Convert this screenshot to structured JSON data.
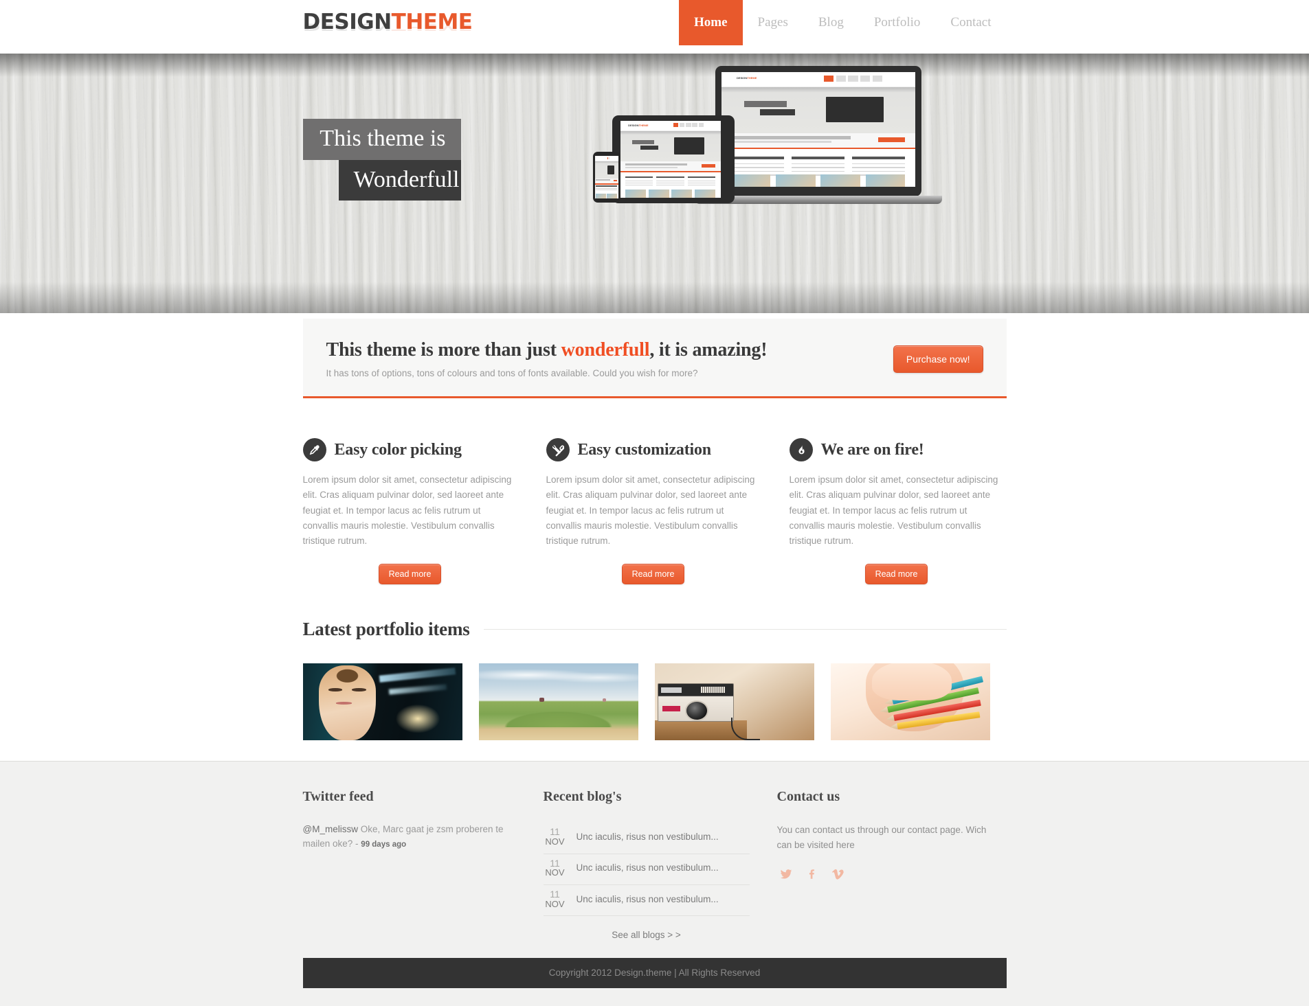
{
  "header": {
    "logo": {
      "part1": "DESIGN",
      "part2": "THEME"
    },
    "nav": [
      {
        "label": "Home",
        "active": true
      },
      {
        "label": "Pages",
        "active": false
      },
      {
        "label": "Blog",
        "active": false
      },
      {
        "label": "Portfolio",
        "active": false
      },
      {
        "label": "Contact",
        "active": false
      }
    ]
  },
  "hero": {
    "caption_line1": "This theme is",
    "caption_line2": "Wonderfull",
    "mockup_logo1": "DESIGN",
    "mockup_logo2": "THEME"
  },
  "cta": {
    "heading_pre": "This theme is more than just ",
    "heading_highlight": "wonderfull",
    "heading_post": ", it is amazing!",
    "subheading": "It has tons of options, tons of colours and tons of fonts available. Could you wish for more?",
    "button_label": "Purchase now!"
  },
  "features": [
    {
      "icon": "eyedropper-icon",
      "title": "Easy color picking",
      "body": "Lorem ipsum dolor sit amet, consectetur adipiscing elit. Cras aliquam pulvinar dolor, sed laoreet ante feugiat et. In tempor lacus ac felis rutrum ut convallis mauris molestie. Vestibulum convallis tristique rutrum.",
      "button_label": "Read more"
    },
    {
      "icon": "tools-icon",
      "title": "Easy customization",
      "body": "Lorem ipsum dolor sit amet, consectetur adipiscing elit. Cras aliquam pulvinar dolor, sed laoreet ante feugiat et. In tempor lacus ac felis rutrum ut convallis mauris molestie. Vestibulum convallis tristique rutrum.",
      "button_label": "Read more"
    },
    {
      "icon": "flame-icon",
      "title": "We are on fire!",
      "body": "Lorem ipsum dolor sit amet, consectetur adipiscing elit. Cras aliquam pulvinar dolor, sed laoreet ante feugiat et. In tempor lacus ac felis rutrum ut convallis mauris molestie. Vestibulum convallis tristique rutrum.",
      "button_label": "Read more"
    }
  ],
  "portfolio": {
    "title": "Latest portfolio items",
    "items": [
      {
        "alt": "portrait-woman-teal-lights"
      },
      {
        "alt": "beach-grass-field-horizon"
      },
      {
        "alt": "vintage-kodak-camera"
      },
      {
        "alt": "hand-holding-colored-pencils"
      }
    ]
  },
  "footer": {
    "twitter": {
      "title": "Twitter feed",
      "handle": "@M_melissw",
      "text": " Oke, Marc gaat je zsm proberen te mailen oke? - ",
      "ago": "99 days ago"
    },
    "blog": {
      "title": "Recent blog's",
      "posts": [
        {
          "day": "11",
          "month": "NOV",
          "text": "Unc iaculis, risus non vestibulum..."
        },
        {
          "day": "11",
          "month": "NOV",
          "text": "Unc iaculis, risus non vestibulum..."
        },
        {
          "day": "11",
          "month": "NOV",
          "text": "Unc iaculis, risus non vestibulum..."
        }
      ],
      "see_all": "See all blogs > >"
    },
    "contact": {
      "title": "Contact us",
      "text": "You can contact us through our contact page. Wich can be visited here",
      "socials": [
        {
          "icon": "twitter-icon",
          "name": "twitter"
        },
        {
          "icon": "facebook-icon",
          "name": "facebook"
        },
        {
          "icon": "vimeo-icon",
          "name": "vimeo"
        }
      ]
    },
    "copyright": "Copyright 2012 Design.theme | All Rights Reserved"
  },
  "colors": {
    "accent": "#e8592c",
    "accent_bright": "#f04e23",
    "dark": "#3b3b3b",
    "caption_gray": "#706f6f",
    "footer_bg": "#f1f1f0",
    "copyright_bg": "#333333",
    "social_pink": "#f2c0ac"
  }
}
